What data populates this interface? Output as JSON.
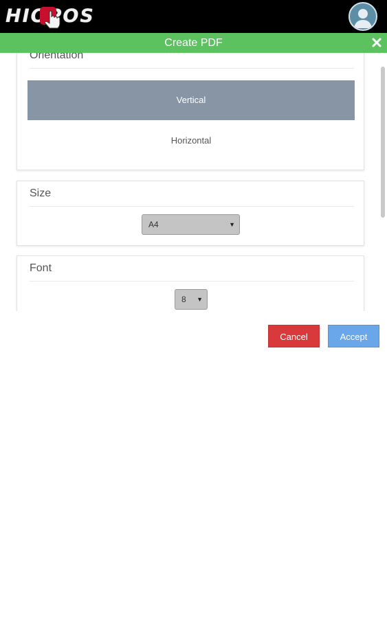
{
  "topbar": {
    "logo_text": "HIOPOS",
    "logo_icon": "hand-pointer-icon",
    "avatar_icon": "user-avatar-icon"
  },
  "dialog": {
    "title": "Create PDF",
    "close_icon": "close-icon"
  },
  "orientation": {
    "header": "Orientation",
    "options": [
      "Vertical",
      "Horizontal"
    ],
    "selected": "Vertical"
  },
  "size": {
    "header": "Size",
    "value": "A4"
  },
  "font": {
    "header": "Font",
    "value": "8"
  },
  "actions": {
    "cancel_label": "Cancel",
    "accept_label": "Accept"
  },
  "colors": {
    "topbar": "#000000",
    "titlebar": "#5cc15f",
    "selected_option": "#8895a4",
    "cancel": "#d9393b",
    "accept": "#6aa6ea"
  }
}
